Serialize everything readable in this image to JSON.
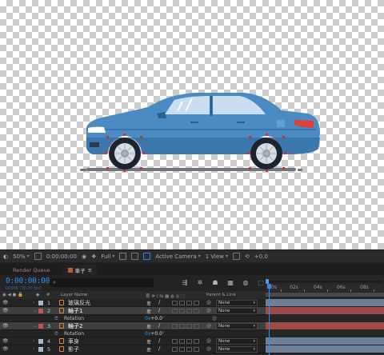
{
  "viewer": {
    "zoom": "50%",
    "timecode": "0:00:00:00",
    "resolution": "Full",
    "view": "Active Camera",
    "views": "1 View",
    "exposure": "+0.0"
  },
  "tabs": [
    {
      "label": "Render Queue"
    },
    {
      "label": "車子"
    }
  ],
  "timeline": {
    "timecode": "0:00:00:00",
    "fps": "00000 (30.00 fps)",
    "search_placeholder": "",
    "ruler": [
      "0s",
      "02s",
      "04s",
      "06s",
      "08s"
    ],
    "columns": {
      "layer_name": "Layer Name",
      "parent": "Parent & Link"
    }
  },
  "layers": [
    {
      "num": "1",
      "name": "玻璃反光",
      "color": "#a7b6c8",
      "parent": "None",
      "bar_color": "#6f7f96"
    },
    {
      "num": "2",
      "name": "輪子1",
      "color": "#c0564e",
      "parent": "None",
      "bar_color": "#9e4a46",
      "selected": true,
      "property": {
        "name": "Rotation",
        "value_prefix": "0x",
        "value": "+0.0",
        "unit": "°"
      }
    },
    {
      "num": "3",
      "name": "輪子2",
      "color": "#c0564e",
      "parent": "None",
      "bar_color": "#9e4a46",
      "selected": true,
      "property": {
        "name": "Rotation",
        "value_prefix": "0x",
        "value": "+0.0",
        "unit": "°"
      }
    },
    {
      "num": "4",
      "name": "車身",
      "color": "#a7b6c8",
      "parent": "None",
      "bar_color": "#6f7f96"
    },
    {
      "num": "5",
      "name": "影子",
      "color": "#a7b6c8",
      "parent": "None",
      "bar_color": "#6f7f96"
    }
  ],
  "colors": {
    "accent": "#2d8ceb",
    "car_body": "#4a8bc4",
    "car_dark": "#2f5f8f",
    "keyframe_handle": "#cc3030"
  }
}
